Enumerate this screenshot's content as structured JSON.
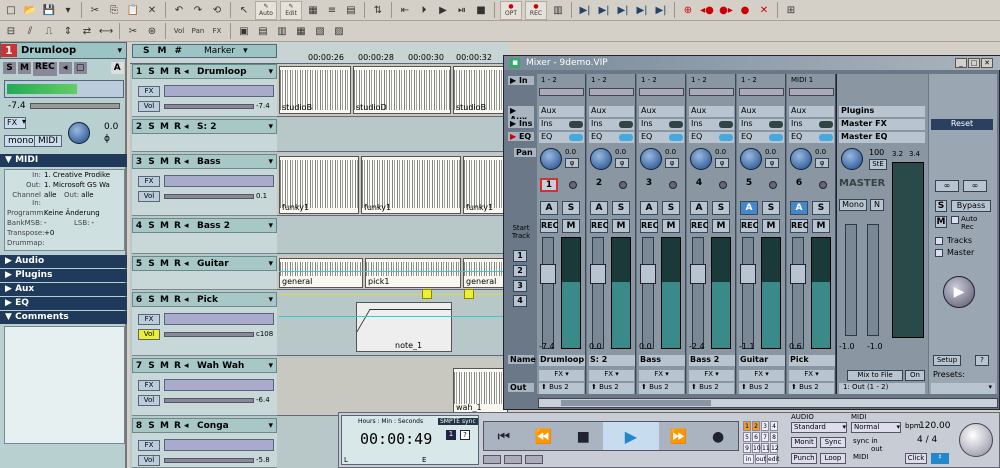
{
  "toolbar": {
    "auto_label": "Auto",
    "edit_label": "Edit",
    "opt_label": "OPT",
    "rec_label": "REC",
    "vol_label": "Vol",
    "pan_label": "Pan",
    "fx_label": "FX"
  },
  "inspector": {
    "track_number": "1",
    "track_name": "Drumloop",
    "volume_value": "-7.4",
    "pan_value": "0.0",
    "fx_label": "FX",
    "mono_label": "mono",
    "midi_label": "MIDI",
    "midi_section": "MIDI",
    "in_label": "In:",
    "in_value": "1. Creative Prodike",
    "out_label": "Out:",
    "out_value": "1. Microsoft GS Wa",
    "channel_in_label": "Channel In:",
    "channel_in_value": "alle",
    "channel_out_label": "Out:",
    "channel_out_value": "alle",
    "programm_label": "Programm:",
    "programm_value": "Keine Änderung",
    "bankmsb_label": "BankMSB:",
    "bankmsb_value": "-",
    "lsb_label": "LSB:",
    "lsb_value": "-",
    "transpose_label": "Transpose:",
    "transpose_value": "+0",
    "drummap_label": "Drummap:",
    "sections": [
      "Audio",
      "Plugins",
      "Aux",
      "EQ",
      "Comments"
    ]
  },
  "ruler": {
    "marker_label": "Marker",
    "times": [
      "00:00:26",
      "00:00:28",
      "00:00:30",
      "00:00:32"
    ]
  },
  "tracks": [
    {
      "num": "1",
      "name": "Drumloop",
      "vol": "-7.4"
    },
    {
      "num": "2",
      "name": "S: 2",
      "vol": ""
    },
    {
      "num": "3",
      "name": "Bass",
      "vol": "0.1"
    },
    {
      "num": "4",
      "name": "Bass 2",
      "vol": ""
    },
    {
      "num": "5",
      "name": "Guitar",
      "vol": ""
    },
    {
      "num": "6",
      "name": "Pick",
      "vol": "c108"
    },
    {
      "num": "7",
      "name": "Wah Wah",
      "vol": "-6.4"
    },
    {
      "num": "8",
      "name": "Conga",
      "vol": "-5.8"
    }
  ],
  "clips": {
    "studio1": "studioB",
    "studio2": "studioD",
    "studio3": "studioB",
    "funky1": "funky1",
    "funky2": "funky1",
    "funky3": "funky1",
    "general1": "general",
    "pick1": "pick1",
    "general2": "general",
    "note1": "note_1",
    "wah1": "wah_1"
  },
  "mixer": {
    "title": "Mixer - 9demo.VIP",
    "in_label": "In",
    "aux_label": "Aux",
    "ins_label": "Ins",
    "eq_label": "EQ",
    "pan_label": "Pan",
    "start_track_label": "Start Track",
    "name_label": "Name",
    "out_label": "Out",
    "channels": [
      {
        "num": "1",
        "input": "1 - 2",
        "name": "Drumloop",
        "vol": "-7.4",
        "out": "Bus 2",
        "fx": "FX"
      },
      {
        "num": "2",
        "input": "1 - 2",
        "name": "S: 2",
        "vol": "0.0",
        "out": "Bus 2",
        "fx": "FX"
      },
      {
        "num": "3",
        "input": "1 - 2",
        "name": "Bass",
        "vol": "0.0",
        "out": "Bus 2",
        "fx": "FX"
      },
      {
        "num": "4",
        "input": "1 - 2",
        "name": "Bass 2",
        "vol": "-2.4",
        "out": "Bus 2",
        "fx": "FX"
      },
      {
        "num": "5",
        "input": "1 - 2",
        "name": "Guitar",
        "vol": "-1.1",
        "out": "Bus 2",
        "fx": "FX"
      },
      {
        "num": "6",
        "input": "MIDI 1",
        "name": "Pick",
        "vol": "0.6",
        "out": "Bus 2",
        "fx": "FX"
      }
    ],
    "pan_values": [
      "0.0",
      "0.0",
      "0.0",
      "0.0",
      "0.0",
      "0.0"
    ],
    "plugins_label": "Plugins",
    "master_fx_label": "Master FX",
    "master_eq_label": "Master EQ",
    "reset_label": "Reset",
    "master_label": "MASTER",
    "master_pan": "100",
    "ste_label": "StE",
    "mono_label": "Mono",
    "n_label": "N",
    "master_left": "-1.0",
    "master_right": "-1.0",
    "meter_top": [
      "3.2",
      "3.4"
    ],
    "mix_to_file": "Mix to File",
    "on_label": "On",
    "master_out": "1: Out (1 - 2)",
    "bypass_label": "Bypass",
    "auto_rec_label": "Auto Rec",
    "tracks_label": "Tracks",
    "master_check_label": "Master",
    "setup_label": "Setup",
    "help_label": "?",
    "presets_label": "Presets:",
    "start_tracks": [
      "1",
      "2",
      "3",
      "4"
    ],
    "scale": [
      "6",
      "0",
      "6",
      "12",
      "18",
      "24",
      "30",
      "36",
      "42",
      "48",
      "54",
      "60",
      "70"
    ]
  },
  "transport": {
    "format_label": "Hours : Min : Seconds",
    "smpte_label": "SMPTE sync",
    "time": "00:00:49",
    "l_label": "L",
    "e_label": "E",
    "audio_label": "AUDIO",
    "midi_label": "MIDI",
    "standard_label": "Standard",
    "normal_label": "Normal",
    "bpm_label": "bpm",
    "bpm_value": "120.00",
    "meter_value": "4 / 4",
    "monit_label": "Monit",
    "sync_label": "Sync",
    "punch_label": "Punch",
    "loop_label": "Loop",
    "click_label": "Click",
    "sync_in_out_labels": [
      "sync",
      "in",
      "out"
    ],
    "midi_small": "MIDI",
    "counter_top": [
      "1",
      "2",
      "3",
      "4"
    ],
    "counter_mid": [
      "5",
      "6",
      "7",
      "8"
    ],
    "counter_low": [
      "9",
      "10",
      "11",
      "12"
    ],
    "counter_bottom": [
      "in",
      "out",
      "edit"
    ]
  }
}
